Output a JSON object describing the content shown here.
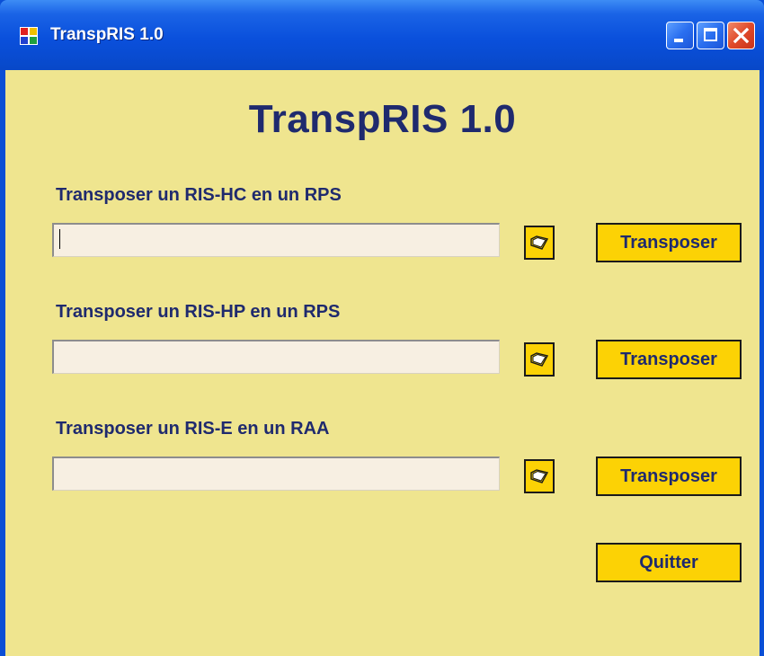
{
  "window": {
    "title": "TranspRIS 1.0",
    "icon": "app-window-icon",
    "controls": [
      "minimize-icon",
      "maximize-icon",
      "close-icon"
    ]
  },
  "main": {
    "heading": "TranspRIS 1.0",
    "sections": [
      {
        "label": "Transposer un RIS-HC en un RPS",
        "path_value": "",
        "browse_icon": "folder-open-icon",
        "button_label": "Transposer"
      },
      {
        "label": "Transposer un RIS-HP en un RPS",
        "path_value": "",
        "browse_icon": "folder-open-icon",
        "button_label": "Transposer"
      },
      {
        "label": "Transposer un RIS-E en un RAA",
        "path_value": "",
        "browse_icon": "folder-open-icon",
        "button_label": "Transposer"
      }
    ],
    "quit_label": "Quitter"
  },
  "colors": {
    "client_background": "#efe58f",
    "button_yellow": "#fcd205",
    "text_navy": "#1f2a6e",
    "titlebar_blue": "#0a50dc",
    "close_red": "#e04a2a"
  }
}
